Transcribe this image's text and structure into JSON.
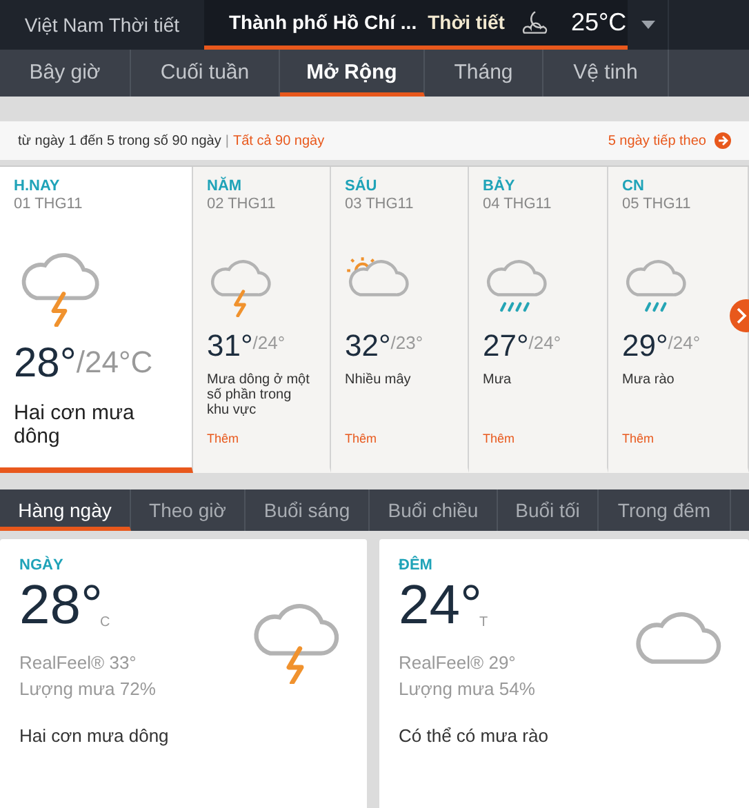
{
  "header": {
    "site": "Việt Nam Thời tiết",
    "city": "Thành phố Hồ Chí ...",
    "label": "Thời tiết",
    "kind": "night_cloudy",
    "temperature": "25°C"
  },
  "nav_tabs": [
    {
      "label": "Bây giờ",
      "selected": false
    },
    {
      "label": "Cuối tuần",
      "selected": false
    },
    {
      "label": "Mở Rộng",
      "selected": true
    },
    {
      "label": "Tháng",
      "selected": false
    },
    {
      "label": "Vệ tinh",
      "selected": false
    }
  ],
  "range_bar": {
    "text": "từ ngày 1 đến 5 trong số 90 ngày",
    "separator": "|",
    "all_link": "Tất cả 90 ngày",
    "next_link": "5 ngày tiếp theo"
  },
  "days": [
    {
      "day": "H.NAY",
      "date": "01 THG11",
      "kind": "thunderstorm",
      "high": "28°",
      "low": "/24°C",
      "description": "Hai cơn mưa dông",
      "selected": true
    },
    {
      "day": "NĂM",
      "date": "02 THG11",
      "kind": "thunderstorm",
      "high": "31°",
      "low": "/24°",
      "description": "Mưa dông ở một số phần trong khu vực",
      "more": "Thêm",
      "selected": false
    },
    {
      "day": "SÁU",
      "date": "03 THG11",
      "kind": "partly_cloudy",
      "high": "32°",
      "low": "/23°",
      "description": "Nhiều mây",
      "more": "Thêm",
      "selected": false
    },
    {
      "day": "BẢY",
      "date": "04 THG11",
      "kind": "rain",
      "high": "27°",
      "low": "/24°",
      "description": "Mưa",
      "more": "Thêm",
      "selected": false
    },
    {
      "day": "CN",
      "date": "05 THG11",
      "kind": "showers",
      "high": "29°",
      "low": "/24°",
      "description": "Mưa rào",
      "more": "Thêm",
      "selected": false
    }
  ],
  "period_tabs": [
    {
      "label": "Hàng ngày",
      "selected": true
    },
    {
      "label": "Theo giờ",
      "selected": false
    },
    {
      "label": "Buổi sáng",
      "selected": false
    },
    {
      "label": "Buổi chiều",
      "selected": false
    },
    {
      "label": "Buổi tối",
      "selected": false
    },
    {
      "label": "Trong đêm",
      "selected": false
    }
  ],
  "details": [
    {
      "title": "NGÀY",
      "temperature": "28°",
      "unit": "C",
      "realfeel": "RealFeel® 33°",
      "precipitation": "Lượng mưa 72%",
      "description": "Hai cơn mưa dông",
      "kind": "thunderstorm"
    },
    {
      "title": "ĐÊM",
      "temperature": "24°",
      "unit": "T",
      "realfeel": "RealFeel® 29°",
      "precipitation": "Lượng mưa 54%",
      "description": "Có thể có mưa rào",
      "kind": "cloudy"
    }
  ]
}
